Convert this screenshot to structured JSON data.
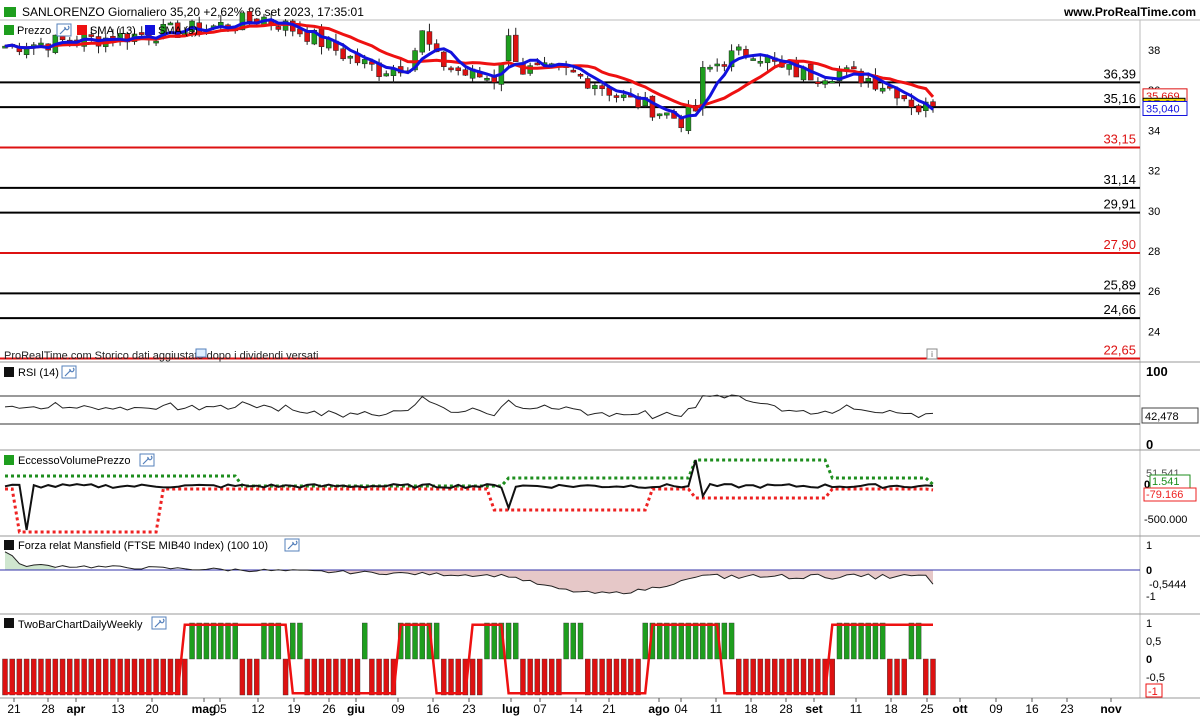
{
  "header": {
    "title": "SANLORENZO Giornaliero 35,20 +2,62% 26 set 2023, 17:35:01",
    "website": "www.ProRealTime.com"
  },
  "price_panel": {
    "legend": [
      {
        "label": "Prezzo",
        "color": "#1e9e1e"
      },
      {
        "label": "SMA (13)",
        "color": "#ee1111"
      },
      {
        "label": "SMA (5)",
        "color": "#1111dd"
      }
    ],
    "note": "ProRealTime.com Storico dati aggiustato dopo i dividendi versati",
    "info_glyph": "i",
    "yaxis_ticks": [
      "38",
      "36",
      "34",
      "32",
      "30",
      "28",
      "26",
      "24"
    ],
    "level_lines": [
      {
        "label": "36,39",
        "value": 36.39,
        "color": "#000000"
      },
      {
        "label": "35,16",
        "value": 35.16,
        "color": "#000000"
      },
      {
        "label": "33,15",
        "value": 33.15,
        "color": "#dd1111"
      },
      {
        "label": "31,14",
        "value": 31.14,
        "color": "#000000"
      },
      {
        "label": "29,91",
        "value": 29.91,
        "color": "#000000"
      },
      {
        "label": "27,90",
        "value": 27.9,
        "color": "#dd1111"
      },
      {
        "label": "25,89",
        "value": 25.89,
        "color": "#000000"
      },
      {
        "label": "24,66",
        "value": 24.66,
        "color": "#000000"
      },
      {
        "label": "22,65",
        "value": 22.65,
        "color": "#dd1111"
      }
    ],
    "price_badges": [
      {
        "label": "35,669",
        "value": 35.669,
        "color": "#dd1111",
        "role": "sma13"
      },
      {
        "label": "35,20",
        "value": 35.2,
        "color": "#f2d600",
        "role": "last"
      },
      {
        "label": "35,040",
        "value": 35.04,
        "color": "#1111dd",
        "role": "sma5"
      }
    ]
  },
  "rsi_panel": {
    "title": "RSI (14)",
    "ticks": [
      "100",
      "0"
    ],
    "value_label": "42,478",
    "levels": [
      70,
      30
    ]
  },
  "volume_panel": {
    "title": "EccessoVolumePrezzo",
    "labels": [
      "51.541",
      "1.541",
      "-79.166",
      "-500.000"
    ],
    "zero_label": "0"
  },
  "mansfield_panel": {
    "title": "Forza relat Mansfield (FTSE MIB40 Index) (100 10)",
    "ticks": [
      "1",
      "0",
      "-1"
    ],
    "value_label": "-0,5444"
  },
  "twobar_panel": {
    "title": "TwoBarChartDailyWeekly",
    "ticks": [
      "1",
      "0,5",
      "0",
      "-0,5"
    ],
    "value_label": "-1"
  },
  "xaxis": {
    "labels": [
      {
        "text": "21",
        "bold": false
      },
      {
        "text": "28",
        "bold": false
      },
      {
        "text": "apr",
        "bold": true
      },
      {
        "text": "13",
        "bold": false
      },
      {
        "text": "20",
        "bold": false
      },
      {
        "text": "mag",
        "bold": true
      },
      {
        "text": "05",
        "bold": false
      },
      {
        "text": "12",
        "bold": false
      },
      {
        "text": "19",
        "bold": false
      },
      {
        "text": "26",
        "bold": false
      },
      {
        "text": "giu",
        "bold": true
      },
      {
        "text": "09",
        "bold": false
      },
      {
        "text": "16",
        "bold": false
      },
      {
        "text": "23",
        "bold": false
      },
      {
        "text": "lug",
        "bold": true
      },
      {
        "text": "07",
        "bold": false
      },
      {
        "text": "14",
        "bold": false
      },
      {
        "text": "21",
        "bold": false
      },
      {
        "text": "ago",
        "bold": true
      },
      {
        "text": "04",
        "bold": false
      },
      {
        "text": "11",
        "bold": false
      },
      {
        "text": "18",
        "bold": false
      },
      {
        "text": "28",
        "bold": false
      },
      {
        "text": "set",
        "bold": true
      },
      {
        "text": "11",
        "bold": false
      },
      {
        "text": "18",
        "bold": false
      },
      {
        "text": "25",
        "bold": false
      },
      {
        "text": "ott",
        "bold": true
      },
      {
        "text": "09",
        "bold": false
      },
      {
        "text": "16",
        "bold": false
      },
      {
        "text": "23",
        "bold": false
      },
      {
        "text": "nov",
        "bold": true
      }
    ]
  },
  "colors": {
    "up": "#1e9e1e",
    "down": "#dd1111",
    "sma13": "#ee1111",
    "sma5": "#1111dd",
    "grid": "#000000",
    "volume_upper": "#1e8e1e",
    "volume_lower": "#ee2222",
    "mansfield_fill": "#e6c8c8"
  },
  "chart_data": {
    "type": "line",
    "title": "SANLORENZO Giornaliero 35,20 +2,62% 26 set 2023, 17:35:01",
    "xlabel": "",
    "ylabel": "",
    "ylim": [
      22,
      40
    ],
    "x": [
      "apr",
      "mag",
      "giu",
      "lug",
      "ago",
      "set",
      "ott",
      "nov"
    ],
    "series": [
      {
        "name": "Prezzo",
        "values": [
          39.0,
          39.4,
          37.3,
          37.0,
          34.6,
          36.8,
          35.0,
          35.2
        ]
      },
      {
        "name": "SMA (13)",
        "values": [
          38.8,
          39.2,
          37.6,
          37.2,
          35.0,
          37.0,
          35.7,
          35.669
        ]
      },
      {
        "name": "SMA (5)",
        "values": [
          38.9,
          39.3,
          37.5,
          37.1,
          34.6,
          37.4,
          35.1,
          35.04
        ]
      }
    ]
  }
}
